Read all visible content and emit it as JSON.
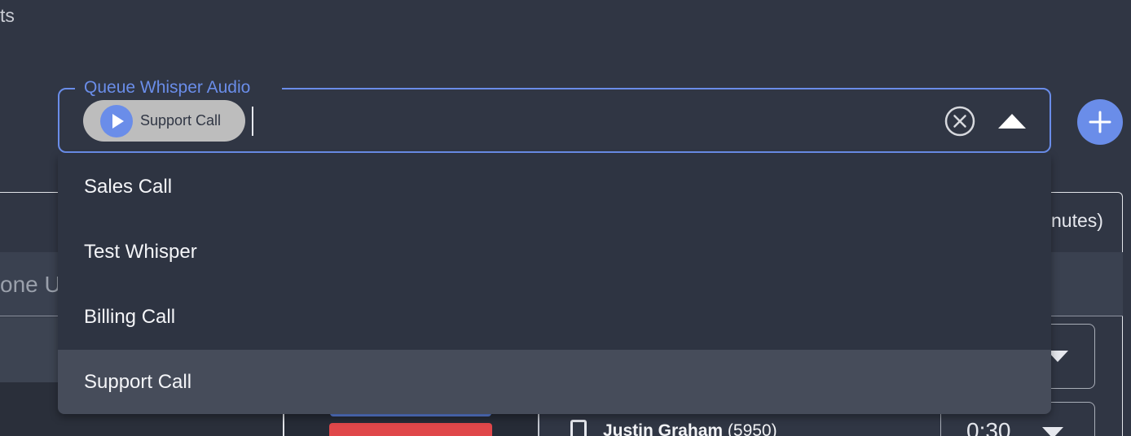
{
  "background": {
    "top_fragment": "ts",
    "card_header_fragment": "nutes)",
    "band_fragment": "one U",
    "person_name": "Justin Graham",
    "person_ext": "(5950)",
    "timer_value": "0:30"
  },
  "queue_whisper": {
    "label": "Queue Whisper Audio",
    "selected_chip": "Support Call",
    "input_value": "",
    "options": [
      {
        "label": "Sales Call",
        "selected": false
      },
      {
        "label": "Test Whisper",
        "selected": false
      },
      {
        "label": "Billing Call",
        "selected": false
      },
      {
        "label": "Support Call",
        "selected": true
      }
    ]
  },
  "colors": {
    "accent": "#6a8de9",
    "background": "#303644",
    "menu": "#2e3442",
    "menu_selected": "#464c5a",
    "chip": "#bdbdbd",
    "danger": "#e0474a"
  },
  "icons": {
    "chip_play": "play-icon",
    "clear": "clear-circle-icon",
    "toggle": "caret-up-icon",
    "add": "plus-icon"
  }
}
